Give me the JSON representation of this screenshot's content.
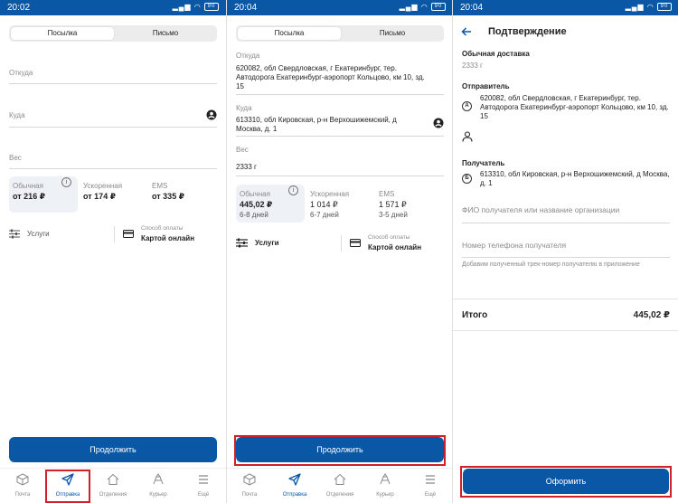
{
  "screens": [
    {
      "time": "20:02",
      "battery": "90",
      "tabs": [
        "Посылка",
        "Письмо"
      ],
      "fields": {
        "from": "Откуда",
        "to": "Куда",
        "weight": "Вес"
      },
      "tariffs": [
        {
          "name": "Обычная",
          "price": "от 216 ₽"
        },
        {
          "name": "Ускоренная",
          "price": "от 174 ₽"
        },
        {
          "name": "EMS",
          "price": "от 335 ₽"
        }
      ],
      "services": "Услуги",
      "payment_caption": "Способ оплаты",
      "payment_value": "Картой онлайн",
      "continue": "Продолжить",
      "nav": [
        "Почта",
        "Отправка",
        "Отделения",
        "Курьер",
        "Ещё"
      ]
    },
    {
      "time": "20:04",
      "battery": "90",
      "tabs": [
        "Посылка",
        "Письмо"
      ],
      "from_label": "Откуда",
      "from_value": "620082, обл Свердловская, г Екатеринбург, тер. Автодорога Екатеринбург-аэропорт Кольцово, км 10, зд. 15",
      "to_label": "Куда",
      "to_value": "613310, обл Кировская, р-н Верхошижемский, д Москва, д. 1",
      "weight_label": "Вес",
      "weight_value": "2333 г",
      "tariffs": [
        {
          "name": "Обычная",
          "price": "445,02 ₽",
          "days": "6-8 дней"
        },
        {
          "name": "Ускоренная",
          "price": "1 014 ₽",
          "days": "6-7 дней"
        },
        {
          "name": "EMS",
          "price": "1 571 ₽",
          "days": "3-5 дней"
        }
      ],
      "services": "Услуги",
      "payment_caption": "Способ оплаты",
      "payment_value": "Картой онлайн",
      "continue": "Продолжить",
      "nav": [
        "Почта",
        "Отправка",
        "Отделения",
        "Курьер",
        "Ещё"
      ]
    },
    {
      "time": "20:04",
      "battery": "90",
      "title": "Подтверждение",
      "delivery_type": "Обычная доставка",
      "weight": "2333 г",
      "sender_label": "Отправитель",
      "sender_badge": "А",
      "sender_address": "620082, обл Свердловская, г Екатеринбург, тер. Автодорога Екатеринбург-аэропорт Кольцово, км 10, зд. 15",
      "recipient_label": "Получатель",
      "recipient_badge": "Б",
      "recipient_address": "613310, обл Кировская, р-н Верхошижемский, д Москва, д. 1",
      "name_placeholder": "ФИО получателя или название организации",
      "phone_placeholder": "Номер телефона получателя",
      "phone_hint": "Добавим полученный трек-номер получателю в приложение",
      "total_label": "Итого",
      "total_value": "445,02 ₽",
      "submit": "Оформить"
    }
  ],
  "colors": {
    "primary": "#0a57a6",
    "highlight": "#d0202a",
    "tariff_selected": "#eef1f6"
  }
}
